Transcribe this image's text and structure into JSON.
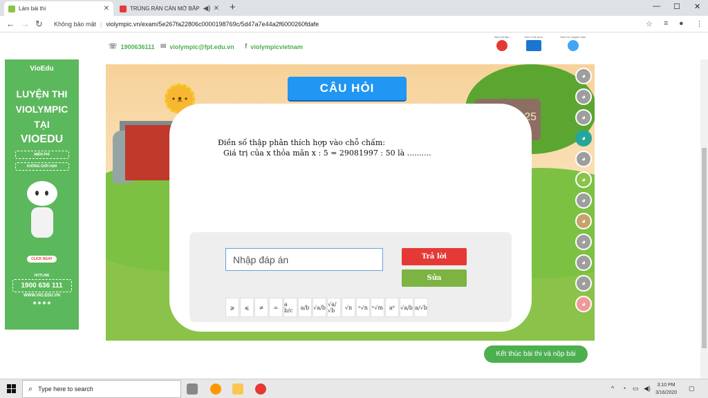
{
  "browser": {
    "tabs": [
      {
        "label": "Làm bài thi",
        "active": true
      },
      {
        "label": "TRÙNG RÀN CĂN MỞ BẮP C",
        "active": false
      }
    ],
    "address": {
      "security": "Không bảo mật",
      "url": "violympic.vn/exam/5e267fa22806c0000198769c/5d47a7e44a2f6000260fdafe"
    }
  },
  "site_header": {
    "phone": "1900636111",
    "email": "violympic@fpt.edu.vn",
    "facebook": "violympicvietnam",
    "logos": [
      "Ban chỉ đạo",
      "Đơn vị tổ chức",
      "Đơn trợ chuyên môn"
    ]
  },
  "banner": {
    "brand": "VioEdu",
    "line1": "LUYỆN THI",
    "line2": "VIOLYMPIC",
    "line3": "TẠI",
    "line4": "VIOEDU",
    "free": "MIỄN PHÍ",
    "unlimited": "KHÔNG GIỚI HẠN",
    "click": "CLICK NGAY",
    "hotline_label": "HOTLINE",
    "hotline": "1900 636 111",
    "website": "WWW.VIO.EDU.VN"
  },
  "game": {
    "ribbon": "CÂU HỎI",
    "sign_value": "25",
    "question_line1": "Điền số thập phân thích hợp vào chỗ chấm:",
    "question_line2": "Giá trị của x thỏa mãn x : 5 = 29081997 : 50 là ..........",
    "answer_placeholder": "Nhập đáp án",
    "answer_button": "Trả lời",
    "edit_button": "Sửa",
    "symbols": [
      "⩾",
      "⩽",
      "≠",
      "=",
      "a b/c",
      "a/b",
      "√a/b",
      "√a/√b",
      "√n",
      "ⁿ√n",
      "ⁿ√m",
      "aᵇ",
      "√a/b",
      "a/√b"
    ]
  },
  "finish_button": "Kết thúc bài thi và nộp bài",
  "taskbar": {
    "search_placeholder": "Type here to search",
    "time": "3:10 PM",
    "date": "3/16/2020"
  },
  "colors": {
    "accent_green": "#4caf50",
    "red_button": "#e53935",
    "ribbon_blue": "#2196f3"
  }
}
